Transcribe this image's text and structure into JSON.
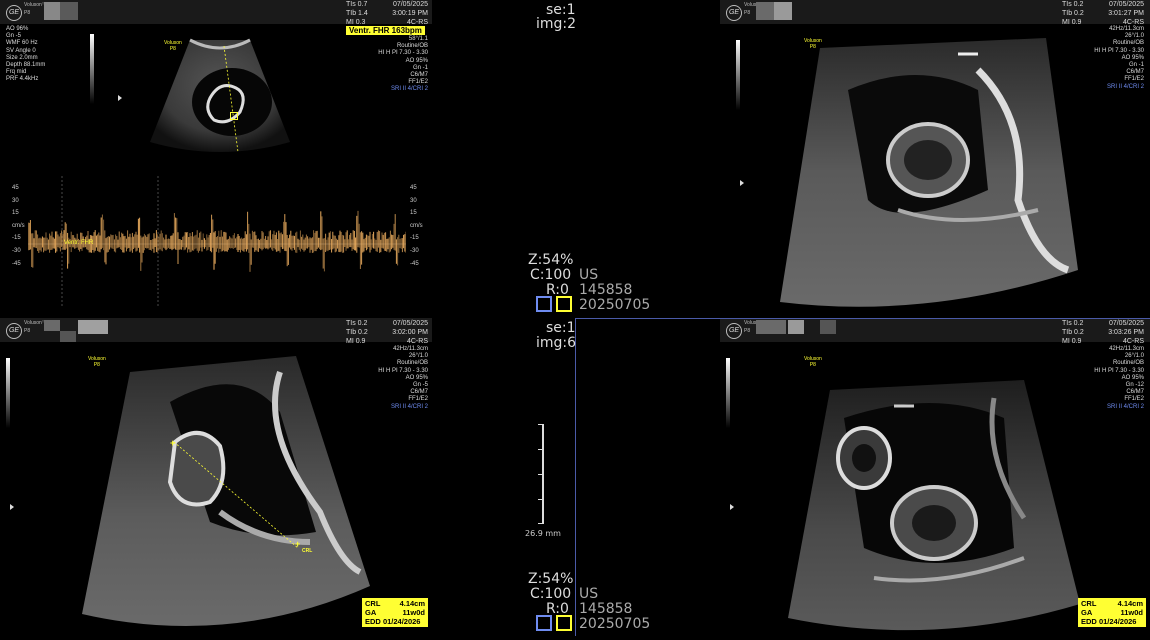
{
  "brand": {
    "logo": "GE",
    "model": "Voluson™",
    "probe": "P8"
  },
  "panels": {
    "tl": {
      "tis": [
        "TIs 0.7",
        "TIb 1.4",
        "MI 0.3"
      ],
      "date": "07/05/2025",
      "time": "3:00:19 PM",
      "preset": "4C-RS",
      "fhr": "Ventr. FHR 163bpm",
      "left_params": [
        "AO 96%",
        "Gn -5",
        "WMF 60 Hz",
        "SV Angle 0",
        "Size 2.0mm",
        "Depth 88.1mm",
        "Frq mid",
        "PRF 4.4kHz"
      ],
      "right_params": [
        "58°/1.1",
        "Routine/OB",
        "HI H PI 7.30 - 3.30",
        "AO 95%",
        "Gn -1",
        "C6/M7",
        "FF1/E2",
        "SRI II 4/CRI 2"
      ],
      "doppler_scale": [
        "45",
        "30",
        "15",
        "cm/s",
        "-15",
        "-30",
        "-45"
      ],
      "doppler_label": "Ventr. FHR"
    },
    "tr": {
      "tis": [
        "TIs 0.2",
        "TIb 0.2",
        "MI 0.9"
      ],
      "date": "07/05/2025",
      "time": "3:01:27 PM",
      "preset": "4C-RS",
      "right_params": [
        "42Hz/11.3cm",
        "26°/1.0",
        "Routine/OB",
        "HI H PI 7.30 - 3.30",
        "AO 95%",
        "Gn -1",
        "C6/M7",
        "FF1/E2",
        "SRI II 4/CRI 2"
      ]
    },
    "bl": {
      "tis": [
        "TIs 0.2",
        "TIb 0.2",
        "MI 0.9"
      ],
      "date": "07/05/2025",
      "time": "3:02:00 PM",
      "preset": "4C-RS",
      "right_params": [
        "42Hz/11.3cm",
        "26°/1.0",
        "Routine/OB",
        "HI H PI 7.30 - 3.30",
        "AO 95%",
        "Gn -5",
        "C6/M7",
        "FF1/E2",
        "SRI II 4/CRI 2"
      ],
      "marker": "CRL",
      "measurements": {
        "crl_label": "CRL",
        "crl": "4.14cm",
        "ga_label": "GA",
        "ga": "11w0d",
        "edd_label": "EDD",
        "edd": "01/24/2026"
      }
    },
    "br": {
      "tis": [
        "TIs 0.2",
        "TIb 0.2",
        "MI 0.9"
      ],
      "date": "07/05/2025",
      "time": "3:03:26 PM",
      "preset": "4C-RS",
      "right_params": [
        "42Hz/11.3cm",
        "26°/1.0",
        "Routine/OB",
        "HI H PI 7.30 - 3.30",
        "AO 95%",
        "Gn -12",
        "C6/M7",
        "FF1/E2",
        "SRI II 4/CRI 2"
      ],
      "measurements": {
        "crl_label": "CRL",
        "crl": "4.14cm",
        "ga_label": "GA",
        "ga": "11w0d",
        "edd_label": "EDD",
        "edd": "01/24/2026"
      }
    }
  },
  "center_top": {
    "se": "se:1",
    "img": "img:2",
    "z": "Z:54%",
    "c": "C:100",
    "us": "US",
    "r": "R:0",
    "id": "145858",
    "date": "20250705"
  },
  "center_bottom": {
    "se": "se:1",
    "img": "img:6",
    "depth": "26.9 mm",
    "z": "Z:54%",
    "c": "C:100",
    "us": "US",
    "r": "R:0",
    "id": "145858",
    "date": "20250705"
  },
  "colors": {
    "accent_yellow": "#ffff33",
    "info_blue": "#6f8cf0",
    "divider_blue": "#4a5aa8",
    "doppler": "#f0b060"
  }
}
